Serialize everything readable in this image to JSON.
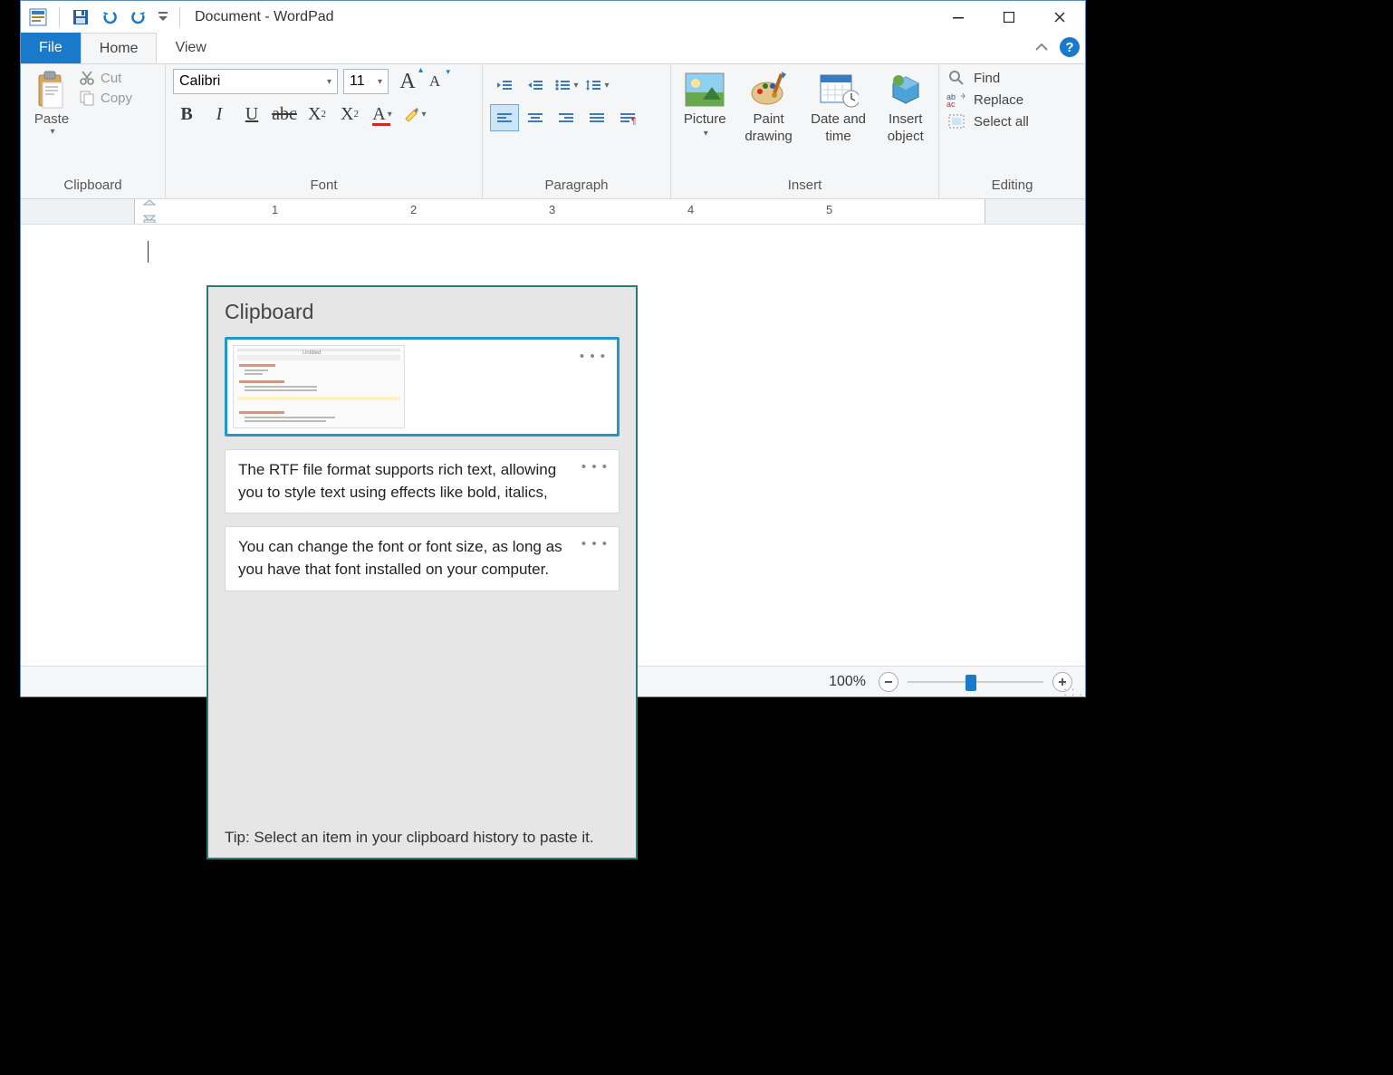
{
  "titlebar": {
    "title": "Document - WordPad"
  },
  "tabs": {
    "file": "File",
    "home": "Home",
    "view": "View"
  },
  "clipboard_group": {
    "label": "Clipboard",
    "paste": "Paste",
    "cut": "Cut",
    "copy": "Copy"
  },
  "font_group": {
    "label": "Font",
    "font_name": "Calibri",
    "font_size": "11"
  },
  "paragraph_group": {
    "label": "Paragraph"
  },
  "insert_group": {
    "label": "Insert",
    "picture": "Picture",
    "paint": "Paint drawing",
    "datetime": "Date and time",
    "object": "Insert object"
  },
  "editing_group": {
    "label": "Editing",
    "find": "Find",
    "replace": "Replace",
    "select_all": "Select all"
  },
  "ruler_numbers": [
    "1",
    "2",
    "3",
    "4",
    "5"
  ],
  "status": {
    "zoom": "100%"
  },
  "clipboard_popup": {
    "title": "Clipboard",
    "items": [
      {
        "type": "image"
      },
      {
        "type": "text",
        "text": "The RTF file format supports rich text, allowing you to style text using effects like bold, italics,"
      },
      {
        "type": "text",
        "text": "You can change the font or font size, as long as you have that font installed on your computer."
      }
    ],
    "tip": "Tip: Select an item in your clipboard history to paste it."
  }
}
